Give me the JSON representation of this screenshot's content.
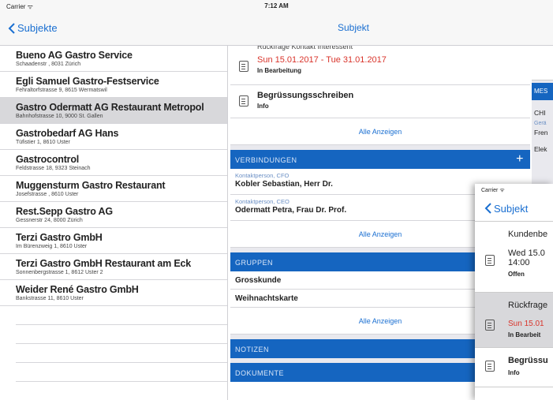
{
  "status": {
    "carrier": "Carrier ᯤ",
    "time": "7:12 AM"
  },
  "nav": {
    "back_label": "Subjekte",
    "title": "Subjekt"
  },
  "list": [
    {
      "name": "Bueno AG Gastro Service",
      "address": "Schaadenstr , 8031 Zürich",
      "selected": false
    },
    {
      "name": "Egli Samuel Gastro-Festservice",
      "address": "Fehraltorfstrasse 9, 8615 Wermatswil",
      "selected": false
    },
    {
      "name": "Gastro Odermatt AG Restaurant Metropol",
      "address": "Bahnhofstrasse 10, 9000 St. Gallen",
      "selected": true
    },
    {
      "name": "Gastrobedarf AG Hans",
      "address": "Tüfistier 1, 8610 Uster",
      "selected": false
    },
    {
      "name": "Gastrocontrol",
      "address": "Feldstrasse 18, 9323 Steinach",
      "selected": false
    },
    {
      "name": "Muggensturm Gastro Restaurant",
      "address": "Josefstrasse , 8610 Uster",
      "selected": false
    },
    {
      "name": "Rest.Sepp Gastro AG",
      "address": "Gessnerstr 24, 8000 Zürich",
      "selected": false
    },
    {
      "name": "Terzi Gastro GmbH",
      "address": "Im Bürenzweig 1, 8610 Uster",
      "selected": false
    },
    {
      "name": "Terzi Gastro GmbH Restaurant am Eck",
      "address": "Sonnenbergstrasse 1, 8612 Uster 2",
      "selected": false
    },
    {
      "name": "Weider René Gastro GmbH",
      "address": "Bankstrasse 11, 8610 Uster",
      "selected": false
    }
  ],
  "activities": {
    "partial_top": "Rückfrage Kontakt Interessent",
    "date_range": "Sun 15.01.2017 - Tue 31.01.2017",
    "status": "In Bearbeitung",
    "doc_title": "Begrüssungsschreiben",
    "doc_status": "Info",
    "show_all": "Alle Anzeigen"
  },
  "connections": {
    "header": "VERBINDUNGEN",
    "plus": "+",
    "items": [
      {
        "role": "Kontaktperson, CFO",
        "name": "Kobler Sebastian, Herr Dr."
      },
      {
        "role": "Kontaktperson, CEO",
        "name": "Odermatt Petra, Frau Dr. Prof."
      }
    ],
    "show_all": "Alle Anzeigen"
  },
  "groups": {
    "header": "GRUPPEN",
    "items": [
      "Grosskunde",
      "Weihnachtskarte"
    ],
    "show_all": "Alle Anzeigen"
  },
  "notes": {
    "header": "NOTIZEN"
  },
  "documents": {
    "header": "DOKUMENTE"
  },
  "right_panel": {
    "header": "MES",
    "lines": [
      "CHI",
      "Gerä",
      "Fren",
      "Elek"
    ]
  },
  "phone": {
    "carrier": "Carrier ᯤ",
    "back_label": "Subjekt",
    "rows": [
      {
        "line1": "Kundenbe",
        "line2": "Wed 15.0",
        "line3": "14:00",
        "status": "Offen"
      },
      {
        "line1": "Rückfrage",
        "line2": "Sun 15.01",
        "status": "In Bearbeit"
      },
      {
        "line1": "Begrüssu",
        "status": "Info"
      }
    ]
  },
  "colors": {
    "accent": "#1a6fd1",
    "section_header": "#1565c0",
    "overdue": "#d9342b"
  }
}
